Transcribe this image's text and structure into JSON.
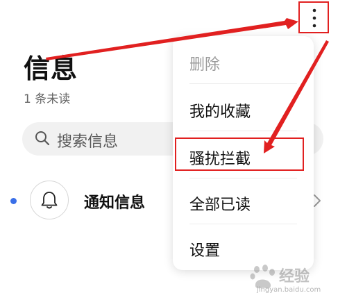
{
  "header": {
    "title": "信息",
    "unread": "1 条未读"
  },
  "search": {
    "placeholder": "搜索信息",
    "icon": "search-icon"
  },
  "list": {
    "items": [
      {
        "title": "通知信息",
        "icon": "bell-icon",
        "unread": true
      }
    ]
  },
  "more_button": {
    "icon": "more-vertical-icon"
  },
  "menu": {
    "items": [
      {
        "label": "删除",
        "enabled": false
      },
      {
        "label": "我的收藏",
        "enabled": true
      },
      {
        "label": "骚扰拦截",
        "enabled": true,
        "highlighted": true
      },
      {
        "label": "全部已读",
        "enabled": true
      },
      {
        "label": "设置",
        "enabled": true
      }
    ]
  },
  "watermark": {
    "brand": "经验",
    "url": "jingyan.baidu.com"
  },
  "colors": {
    "annotation": "#e12020",
    "unread_dot": "#3a6fe8",
    "search_bg": "#f1f1f1"
  }
}
